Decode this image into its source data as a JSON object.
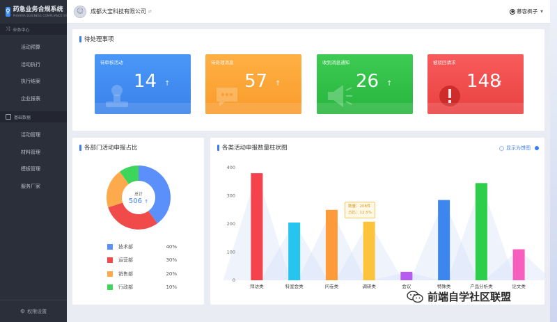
{
  "app": {
    "title": "药急业务合规系统",
    "subtitle": "PHARMA BUSINESS COMPLIANCE SYSTEM"
  },
  "header": {
    "company": "成都大宝科技有限公司",
    "company_switch_icon": "swap-icon",
    "user": "慕容枫子",
    "user_icon": "user-circle-icon",
    "caret_icon": "caret-down-icon"
  },
  "sidebar": {
    "sections": [
      {
        "label": "业务中心",
        "icon": "shuffle-icon",
        "items": [
          "活动预算",
          "活动执行",
          "执行结案",
          "企业报表"
        ]
      },
      {
        "label": "基础数据",
        "icon": "folder-icon",
        "items": [
          "活动管理",
          "材料管理",
          "模板管理",
          "服务厂家"
        ]
      }
    ],
    "bottom": {
      "label": "权限设置",
      "icon": "gear-icon"
    }
  },
  "todo": {
    "title": "待处理事项",
    "cards": [
      {
        "label": "待审核活动",
        "value": "14",
        "arrow": "↑",
        "icon": "stamp-icon",
        "color": "#4a97f8"
      },
      {
        "label": "待处理消息",
        "value": "57",
        "arrow": "↑",
        "icon": "chat-icon",
        "color": "#ffb043"
      },
      {
        "label": "收到消息通知",
        "value": "26",
        "arrow": "↑",
        "icon": "megaphone-icon",
        "color": "#3ecb54"
      },
      {
        "label": "被驳回请求",
        "value": "148",
        "arrow": "↑",
        "icon": "alert-icon",
        "color": "#f75b5b"
      }
    ]
  },
  "dept": {
    "title": "各部门活动申报占比",
    "total_label": "总计",
    "total_value": "506",
    "total_arrow": "↑",
    "legend": [
      {
        "name": "技术部",
        "pct": "40%",
        "value": 40,
        "color": "#5b8ff9"
      },
      {
        "name": "运营部",
        "pct": "30%",
        "value": 30,
        "color": "#f04a4a"
      },
      {
        "name": "销售部",
        "pct": "20%",
        "value": 20,
        "color": "#fdaa4c"
      },
      {
        "name": "行政部",
        "pct": "10%",
        "value": 10,
        "color": "#3dd65b"
      }
    ]
  },
  "stats": {
    "title": "各类活动申报数量柱状图",
    "toggle_label": "显示为饼图",
    "tooltip": {
      "line1": "数量：208件",
      "line2": "占比：12.5%"
    }
  },
  "chart_data": {
    "type": "bar",
    "categories": [
      "拜访类",
      "科室会类",
      "问卷类",
      "调研类",
      "会议",
      "特殊类",
      "产品分析类",
      "论文类"
    ],
    "values": [
      380,
      205,
      250,
      208,
      30,
      285,
      345,
      110
    ],
    "colors": [
      "#f5434d",
      "#28c4f0",
      "#fd9a3a",
      "#fcc33b",
      "#b65cf0",
      "#3d86f0",
      "#2cce4a",
      "#f65fbd"
    ],
    "ylim": [
      0,
      400
    ],
    "yticks": [
      0,
      100,
      200,
      300,
      400
    ],
    "title": "各类活动申报数量柱状图"
  },
  "watermark": {
    "text": "前端自学社区联盟",
    "icon": "wechat-icon"
  }
}
